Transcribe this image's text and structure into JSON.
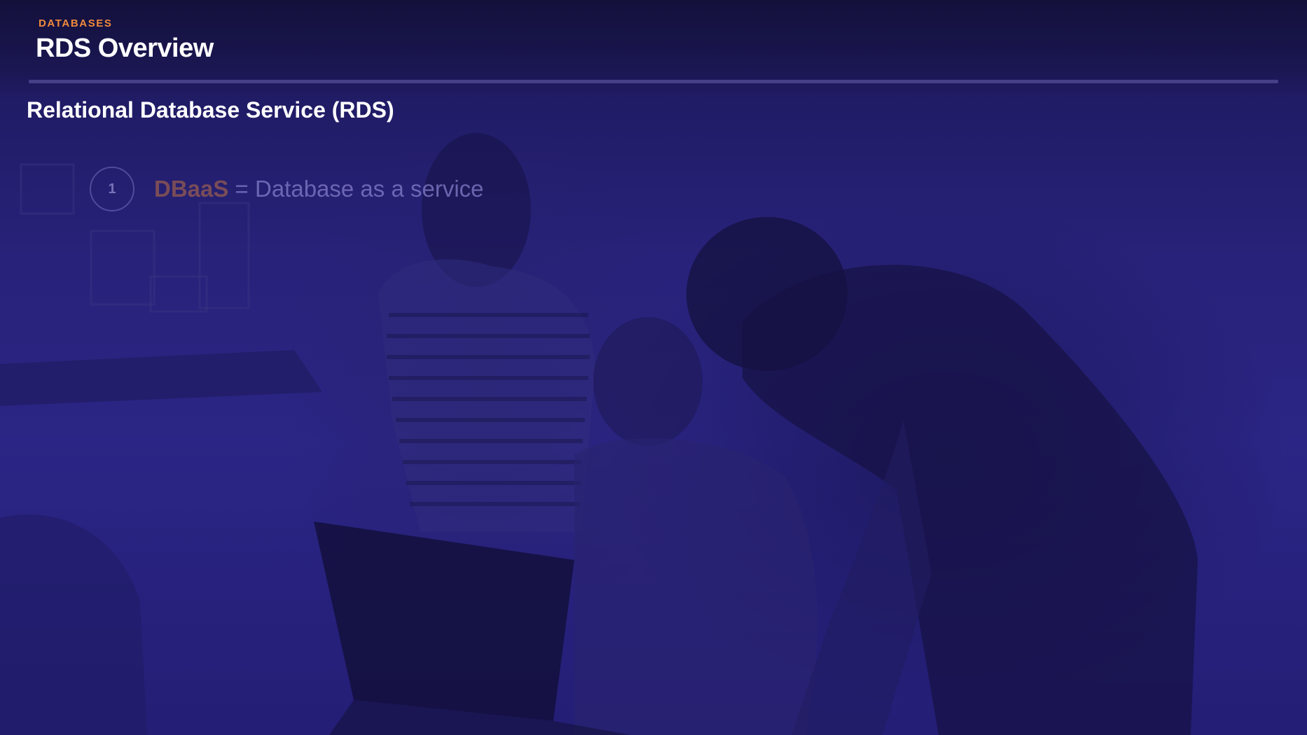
{
  "header": {
    "section_label": "DATABASES",
    "title": "RDS Overview"
  },
  "content": {
    "subtitle": "Relational Database Service (RDS)",
    "bullets": [
      {
        "number": "1",
        "term": "DBaaS",
        "separator": " = ",
        "description": "Database as a service"
      }
    ]
  },
  "background": {
    "image": "photo-three-people-at-laptop",
    "overlay_color": "#28227a",
    "accent_color": "#f08a3c"
  }
}
